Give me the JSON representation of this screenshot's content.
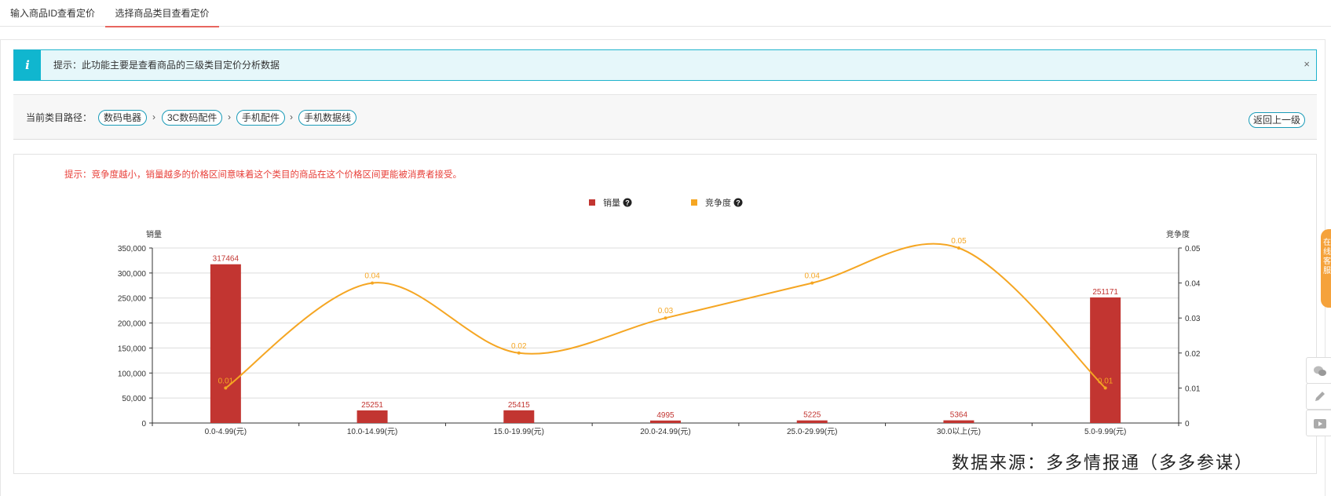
{
  "tabs": [
    {
      "label": "输入商品ID查看定价",
      "active": false
    },
    {
      "label": "选择商品类目查看定价",
      "active": true
    }
  ],
  "notice": {
    "icon": "info-icon",
    "icon_glyph": "i",
    "message": "提示：此功能主要是查看商品的三级类目定价分析数据",
    "close": "×"
  },
  "breadcrumb": {
    "label": "当前类目路径：",
    "items": [
      "数码电器",
      "3C数码配件",
      "手机配件",
      "手机数据线"
    ],
    "separator": "›",
    "back_label": "返回上一级"
  },
  "tip": "提示：竞争度越小，销量越多的价格区间意味着这个类目的商品在这个价格区间更能被消费者接受。",
  "chart_data": {
    "type": "bar",
    "categories": [
      "0.0-4.99(元)",
      "10.0-14.99(元)",
      "15.0-19.99(元)",
      "20.0-24.99(元)",
      "25.0-29.99(元)",
      "30.0以上(元)",
      "5.0-9.99(元)"
    ],
    "series": [
      {
        "name": "销量",
        "type": "bar",
        "axis": "left",
        "color": "#c23531",
        "values": [
          317464,
          25251,
          25415,
          4995,
          5225,
          5364,
          251171
        ]
      },
      {
        "name": "竞争度",
        "type": "line",
        "smooth": true,
        "axis": "right",
        "color": "#f5a623",
        "values": [
          0.01,
          0.04,
          0.02,
          0.03,
          0.04,
          0.05,
          0.01
        ]
      }
    ],
    "ylabel_left": "销量",
    "ylabel_right": "竞争度",
    "ylim_left": [
      0,
      350000
    ],
    "yticks_left": [
      "0",
      "50,000",
      "100,000",
      "150,000",
      "200,000",
      "250,000",
      "300,000",
      "350,000"
    ],
    "ylim_right": [
      0,
      0.05
    ],
    "yticks_right": [
      "0",
      "0.01",
      "0.02",
      "0.03",
      "0.04",
      "0.05"
    ],
    "legend": {
      "placement": "top-center",
      "items": [
        "销量",
        "竞争度"
      ],
      "help_icon": "question-circle-icon"
    },
    "grid": true
  },
  "source_text": "数据来源：多多情报通（多多参谋）",
  "float_tab_text": "在线客服",
  "side_buttons": [
    "wechat-icon",
    "edit-icon",
    "video-icon"
  ]
}
